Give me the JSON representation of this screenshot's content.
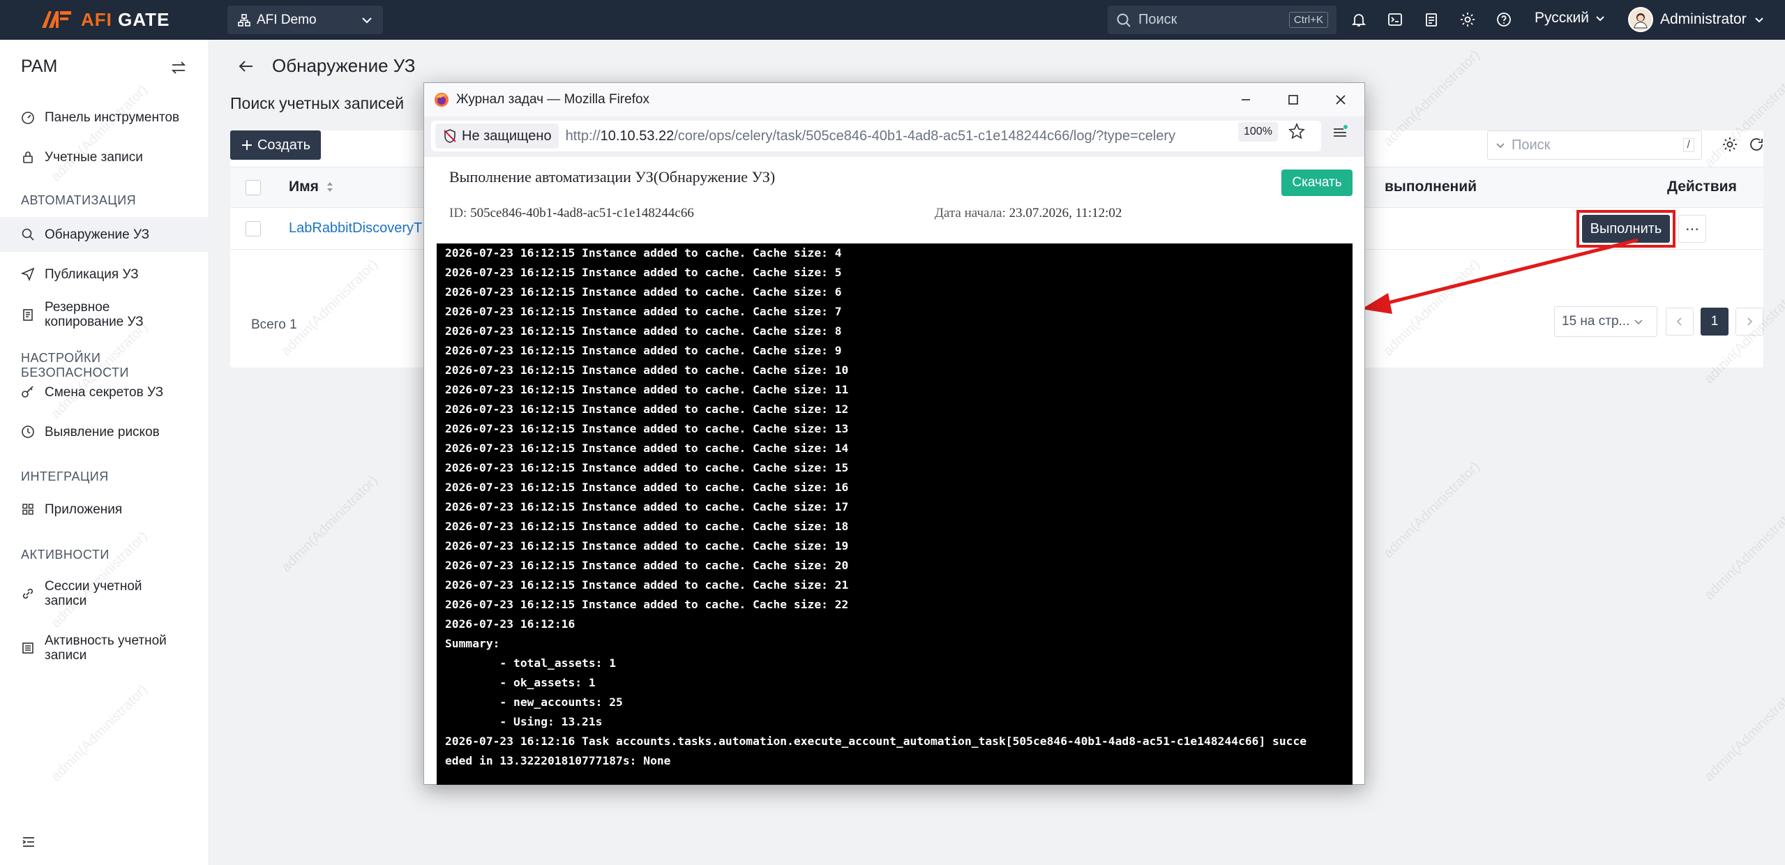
{
  "brand": {
    "part1": "AFI",
    "part2": " GATE"
  },
  "org": {
    "label": "AFI Demo"
  },
  "search": {
    "placeholder": "Поиск",
    "shortcut": "Ctrl+K"
  },
  "language": "Русский",
  "user": "Administrator",
  "sidebar": {
    "title": "PAM",
    "items": [
      {
        "label": "Панель инструментов"
      },
      {
        "label": "Учетные записи"
      },
      {
        "label": "Обнаружение УЗ"
      },
      {
        "label": "Публикация УЗ"
      },
      {
        "label": "Резервное копирование УЗ"
      },
      {
        "label": "Смена секретов УЗ"
      },
      {
        "label": "Выявление рисков"
      },
      {
        "label": "Приложения"
      },
      {
        "label": "Сессии учетной записи"
      },
      {
        "label": "Активность учетной записи"
      }
    ],
    "sections": [
      "АВТОМАТИЗАЦИЯ",
      "НАСТРОЙКИ БЕЗОПАСНОСТИ",
      "ИНТЕГРАЦИЯ",
      "АКТИВНОСТИ"
    ]
  },
  "main": {
    "title": "Обнаружение УЗ",
    "subtitle": "Поиск учетных записей",
    "create_label": "Создать",
    "filter_placeholder": "Поиск",
    "filter_shortcut": "/",
    "columns": {
      "name": "Имя",
      "exec": "выполнений",
      "actions": "Действия"
    },
    "rows": [
      {
        "name": "LabRabbitDiscoveryT",
        "run_label": "Выполнить"
      }
    ],
    "total": "Всего 1",
    "page_size": "15 на стр...",
    "current_page": "1"
  },
  "watermark_text": "admin(Administrator)",
  "popup": {
    "window_title": "Журнал задач — Mozilla Firefox",
    "not_secure": "Не защищено",
    "url_prefix": "http://",
    "url_host": "10.10.53.22",
    "url_path": "/core/ops/celery/task/505ce846-40b1-4ad8-ac51-c1e148244c66/log/?type=celery",
    "zoom": "100%",
    "heading": "Выполнение автоматизации УЗ(Обнаружение УЗ)",
    "download_label": "Скачать",
    "id_label": "ID:",
    "id_value": "505ce846-40b1-4ad8-ac51-c1e148244c66",
    "date_label": "Дата начала:",
    "date_value": "23.07.2026, 11:12:02",
    "log_lines": [
      "2026-07-23 16:12:15 Instance added to cache. Cache size: 4",
      "2026-07-23 16:12:15 Instance added to cache. Cache size: 5",
      "2026-07-23 16:12:15 Instance added to cache. Cache size: 6",
      "2026-07-23 16:12:15 Instance added to cache. Cache size: 7",
      "2026-07-23 16:12:15 Instance added to cache. Cache size: 8",
      "2026-07-23 16:12:15 Instance added to cache. Cache size: 9",
      "2026-07-23 16:12:15 Instance added to cache. Cache size: 10",
      "2026-07-23 16:12:15 Instance added to cache. Cache size: 11",
      "2026-07-23 16:12:15 Instance added to cache. Cache size: 12",
      "2026-07-23 16:12:15 Instance added to cache. Cache size: 13",
      "2026-07-23 16:12:15 Instance added to cache. Cache size: 14",
      "2026-07-23 16:12:15 Instance added to cache. Cache size: 15",
      "2026-07-23 16:12:15 Instance added to cache. Cache size: 16",
      "2026-07-23 16:12:15 Instance added to cache. Cache size: 17",
      "2026-07-23 16:12:15 Instance added to cache. Cache size: 18",
      "2026-07-23 16:12:15 Instance added to cache. Cache size: 19",
      "2026-07-23 16:12:15 Instance added to cache. Cache size: 20",
      "2026-07-23 16:12:15 Instance added to cache. Cache size: 21",
      "2026-07-23 16:12:15 Instance added to cache. Cache size: 22",
      "2026-07-23 16:12:16",
      "Summary:",
      "        - total_assets: 1",
      "        - ok_assets: 1",
      "        - new_accounts: 25",
      "        - Using: 13.21s",
      "2026-07-23 16:12:16 Task accounts.tasks.automation.execute_account_automation_task[505ce846-40b1-4ad8-ac51-c1e148244c66] succe",
      "eded in 13.322201810777187s: None"
    ]
  },
  "colors": {
    "topbar": "#1f2a3a",
    "accent": "#f26b1d",
    "link": "#1a73c7",
    "download": "#1eb38b",
    "highlight": "#e01b1b"
  }
}
